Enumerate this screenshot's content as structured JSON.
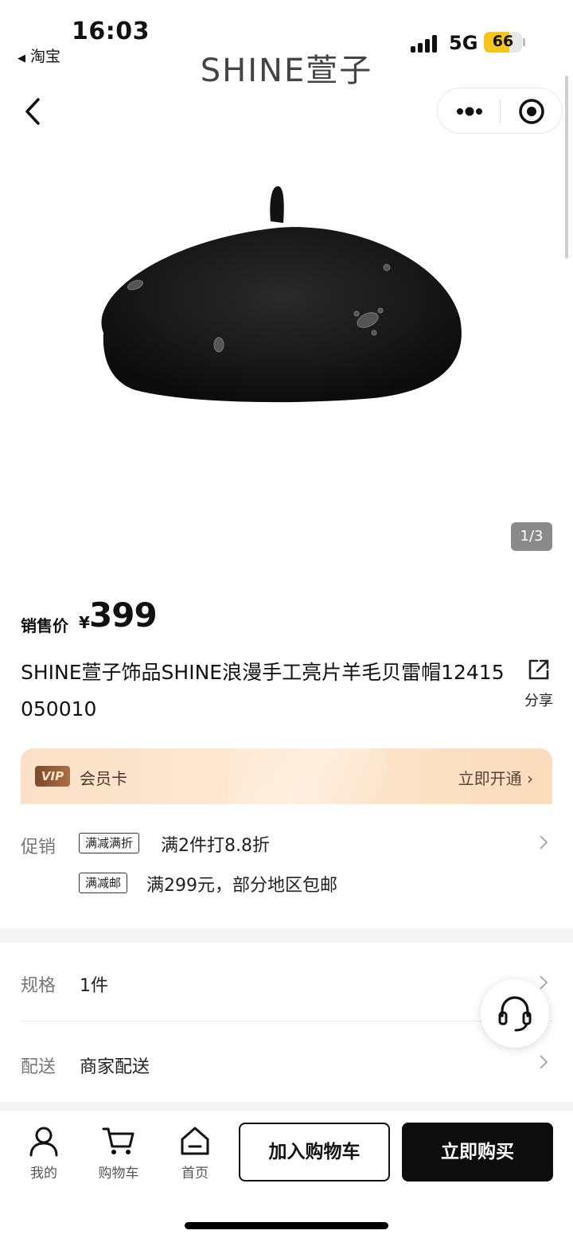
{
  "status_bar": {
    "time": "16:03",
    "back_app": "淘宝",
    "network": "5G",
    "battery": "66",
    "battery_level": 66
  },
  "brand": "SHINE萱子",
  "nav": {
    "back_icon": "chevron-left-icon",
    "more_icon": "more-dots-icon",
    "close_icon": "target-circle-icon"
  },
  "gallery": {
    "counter": "1/3",
    "current": 1,
    "total": 3
  },
  "price": {
    "label": "销售价",
    "currency": "¥",
    "amount": "399"
  },
  "product": {
    "title": "SHINE萱子饰品SHINE浪漫手工亮片羊毛贝雷帽12415050010",
    "share_label": "分享"
  },
  "vip": {
    "badge": "VIP",
    "label": "会员卡",
    "action": "立即开通 ›"
  },
  "promo": {
    "label": "促销",
    "items": [
      {
        "tag": "满减满折",
        "text": "满2件打8.8折"
      },
      {
        "tag": "满减邮",
        "text": "满299元，部分地区包邮"
      }
    ]
  },
  "spec": {
    "label": "规格",
    "value": "1件"
  },
  "delivery": {
    "label": "配送",
    "value": "商家配送"
  },
  "bottom_bar": {
    "tabs": [
      {
        "label": "我的",
        "icon": "user-icon"
      },
      {
        "label": "购物车",
        "icon": "cart-icon"
      },
      {
        "label": "首页",
        "icon": "home-icon"
      }
    ],
    "add_to_cart": "加入购物车",
    "buy_now": "立即购买"
  },
  "colors": {
    "buy_button": "#0d0d0d",
    "vip_banner": "#fbe1c7",
    "battery": "#f5c518"
  }
}
